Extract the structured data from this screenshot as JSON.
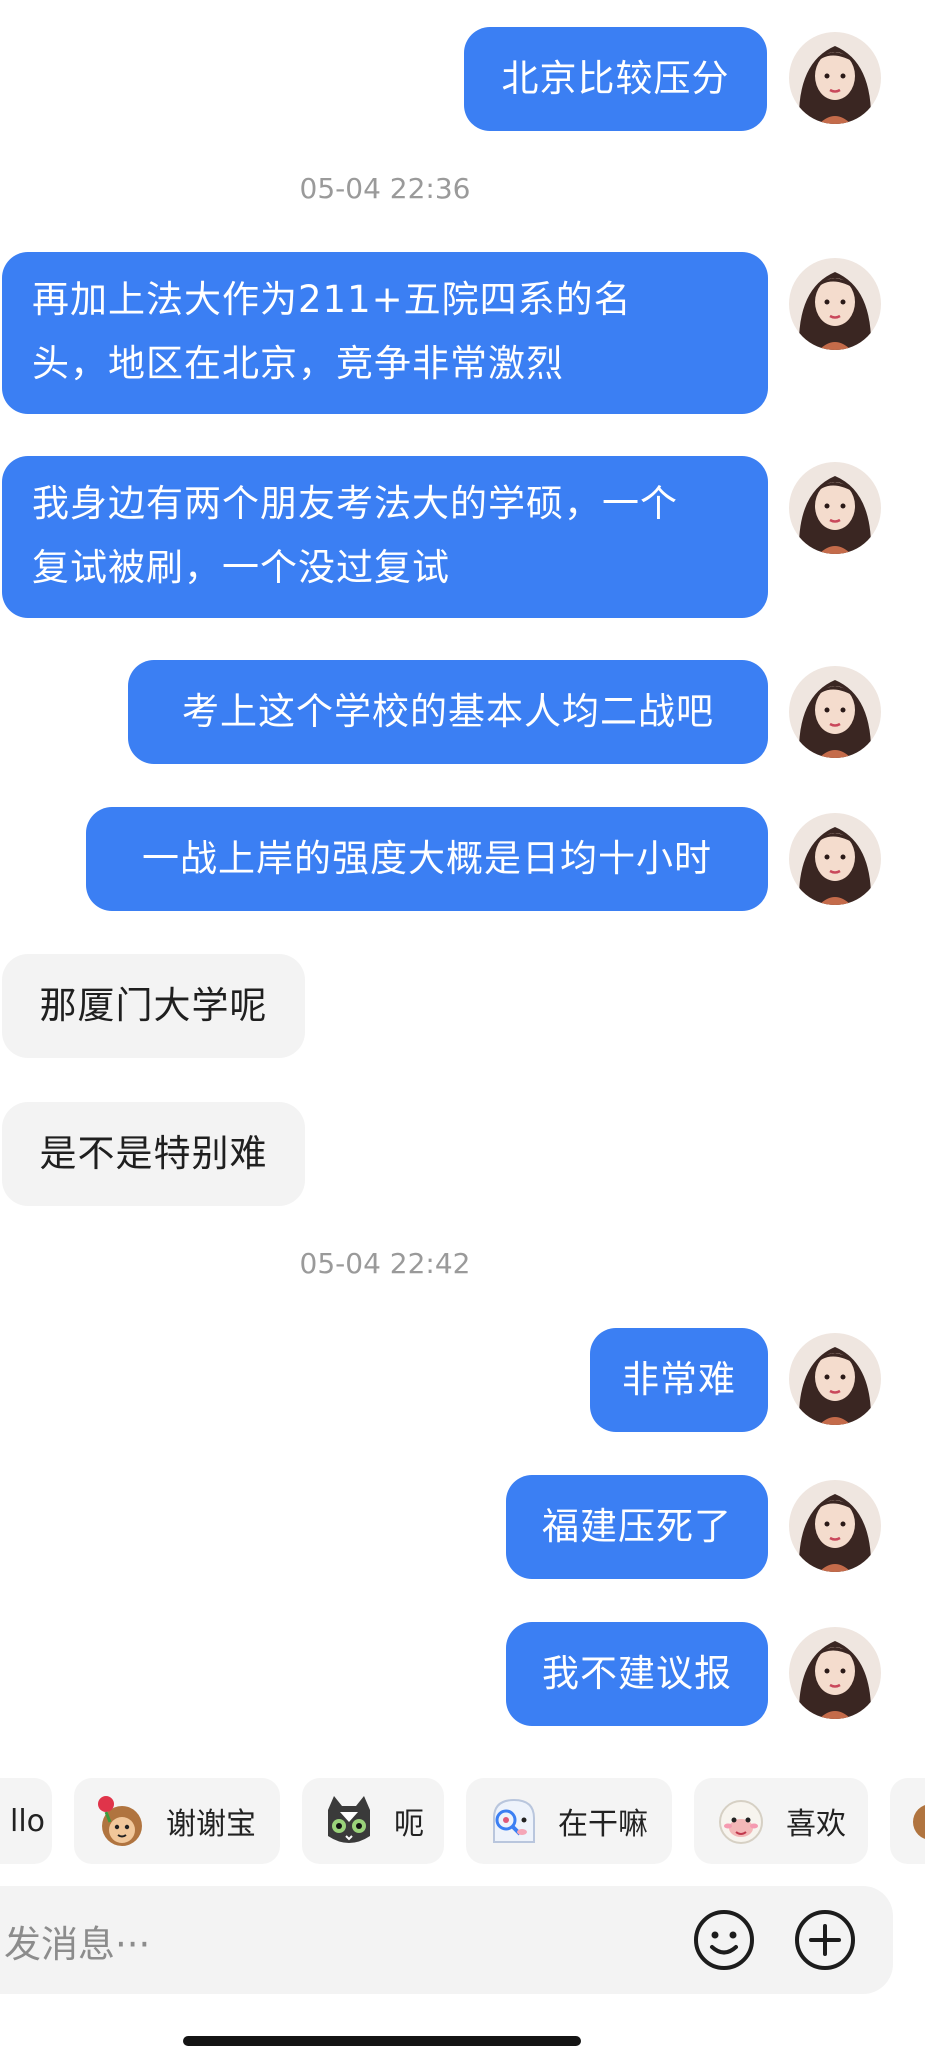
{
  "messages": [
    {
      "side": "out",
      "text": "北京比较压分"
    },
    {
      "timestamp": "05-04 22:36"
    },
    {
      "side": "out",
      "lines": [
        "再加上法大作为211+五院四系的名",
        "头，地区在北京，竞争非常激烈"
      ]
    },
    {
      "side": "out",
      "lines": [
        "我身边有两个朋友考法大的学硕，一个",
        "复试被刷，一个没过复试"
      ]
    },
    {
      "side": "out",
      "text": "考上这个学校的基本人均二战吧"
    },
    {
      "side": "out",
      "text": "一战上岸的强度大概是日均十小时"
    },
    {
      "side": "in",
      "text": "那厦门大学呢"
    },
    {
      "side": "in",
      "text": "是不是特别难"
    },
    {
      "timestamp": "05-04 22:42"
    },
    {
      "side": "out",
      "text": "非常难"
    },
    {
      "side": "out",
      "text": "福建压死了"
    },
    {
      "side": "out",
      "text": "我不建议报"
    }
  ],
  "quick_replies": [
    {
      "label": "llo",
      "icon": "none"
    },
    {
      "label": "谢谢宝",
      "icon": "monkey-rose-sticker-icon"
    },
    {
      "label": "呃",
      "icon": "cat-sticker-icon"
    },
    {
      "label": "在干嘛",
      "icon": "ghost-magnifier-sticker-icon"
    },
    {
      "label": "喜欢",
      "icon": "sheep-sticker-icon"
    }
  ],
  "composer": {
    "placeholder": "发消息···",
    "emoji_icon": "smiley-icon",
    "plus_icon": "plus-circle-icon"
  },
  "colors": {
    "outgoing_bubble": "#3b7ff3",
    "incoming_bubble": "#f3f3f3",
    "timestamp": "#9a9a9a"
  }
}
